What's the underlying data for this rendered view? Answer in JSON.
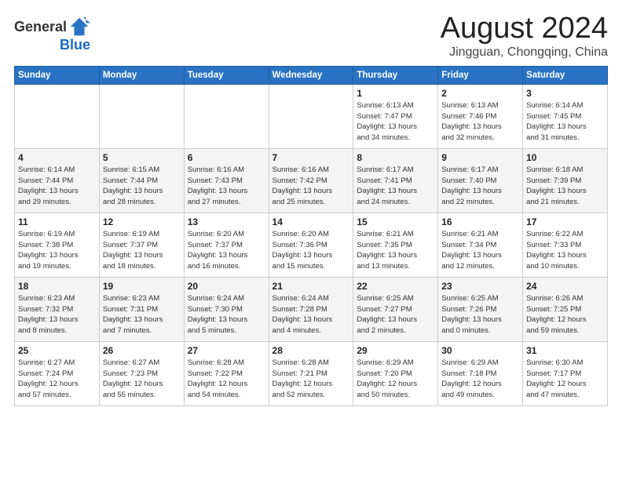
{
  "header": {
    "logo_general": "General",
    "logo_blue": "Blue",
    "month_title": "August 2024",
    "location": "Jingguan, Chongqing, China"
  },
  "weekdays": [
    "Sunday",
    "Monday",
    "Tuesday",
    "Wednesday",
    "Thursday",
    "Friday",
    "Saturday"
  ],
  "weeks": [
    [
      {
        "day": "",
        "info": ""
      },
      {
        "day": "",
        "info": ""
      },
      {
        "day": "",
        "info": ""
      },
      {
        "day": "",
        "info": ""
      },
      {
        "day": "1",
        "info": "Sunrise: 6:13 AM\nSunset: 7:47 PM\nDaylight: 13 hours\nand 34 minutes."
      },
      {
        "day": "2",
        "info": "Sunrise: 6:13 AM\nSunset: 7:46 PM\nDaylight: 13 hours\nand 32 minutes."
      },
      {
        "day": "3",
        "info": "Sunrise: 6:14 AM\nSunset: 7:45 PM\nDaylight: 13 hours\nand 31 minutes."
      }
    ],
    [
      {
        "day": "4",
        "info": "Sunrise: 6:14 AM\nSunset: 7:44 PM\nDaylight: 13 hours\nand 29 minutes."
      },
      {
        "day": "5",
        "info": "Sunrise: 6:15 AM\nSunset: 7:44 PM\nDaylight: 13 hours\nand 28 minutes."
      },
      {
        "day": "6",
        "info": "Sunrise: 6:16 AM\nSunset: 7:43 PM\nDaylight: 13 hours\nand 27 minutes."
      },
      {
        "day": "7",
        "info": "Sunrise: 6:16 AM\nSunset: 7:42 PM\nDaylight: 13 hours\nand 25 minutes."
      },
      {
        "day": "8",
        "info": "Sunrise: 6:17 AM\nSunset: 7:41 PM\nDaylight: 13 hours\nand 24 minutes."
      },
      {
        "day": "9",
        "info": "Sunrise: 6:17 AM\nSunset: 7:40 PM\nDaylight: 13 hours\nand 22 minutes."
      },
      {
        "day": "10",
        "info": "Sunrise: 6:18 AM\nSunset: 7:39 PM\nDaylight: 13 hours\nand 21 minutes."
      }
    ],
    [
      {
        "day": "11",
        "info": "Sunrise: 6:19 AM\nSunset: 7:38 PM\nDaylight: 13 hours\nand 19 minutes."
      },
      {
        "day": "12",
        "info": "Sunrise: 6:19 AM\nSunset: 7:37 PM\nDaylight: 13 hours\nand 18 minutes."
      },
      {
        "day": "13",
        "info": "Sunrise: 6:20 AM\nSunset: 7:37 PM\nDaylight: 13 hours\nand 16 minutes."
      },
      {
        "day": "14",
        "info": "Sunrise: 6:20 AM\nSunset: 7:36 PM\nDaylight: 13 hours\nand 15 minutes."
      },
      {
        "day": "15",
        "info": "Sunrise: 6:21 AM\nSunset: 7:35 PM\nDaylight: 13 hours\nand 13 minutes."
      },
      {
        "day": "16",
        "info": "Sunrise: 6:21 AM\nSunset: 7:34 PM\nDaylight: 13 hours\nand 12 minutes."
      },
      {
        "day": "17",
        "info": "Sunrise: 6:22 AM\nSunset: 7:33 PM\nDaylight: 13 hours\nand 10 minutes."
      }
    ],
    [
      {
        "day": "18",
        "info": "Sunrise: 6:23 AM\nSunset: 7:32 PM\nDaylight: 13 hours\nand 8 minutes."
      },
      {
        "day": "19",
        "info": "Sunrise: 6:23 AM\nSunset: 7:31 PM\nDaylight: 13 hours\nand 7 minutes."
      },
      {
        "day": "20",
        "info": "Sunrise: 6:24 AM\nSunset: 7:30 PM\nDaylight: 13 hours\nand 5 minutes."
      },
      {
        "day": "21",
        "info": "Sunrise: 6:24 AM\nSunset: 7:28 PM\nDaylight: 13 hours\nand 4 minutes."
      },
      {
        "day": "22",
        "info": "Sunrise: 6:25 AM\nSunset: 7:27 PM\nDaylight: 13 hours\nand 2 minutes."
      },
      {
        "day": "23",
        "info": "Sunrise: 6:25 AM\nSunset: 7:26 PM\nDaylight: 13 hours\nand 0 minutes."
      },
      {
        "day": "24",
        "info": "Sunrise: 6:26 AM\nSunset: 7:25 PM\nDaylight: 12 hours\nand 59 minutes."
      }
    ],
    [
      {
        "day": "25",
        "info": "Sunrise: 6:27 AM\nSunset: 7:24 PM\nDaylight: 12 hours\nand 57 minutes."
      },
      {
        "day": "26",
        "info": "Sunrise: 6:27 AM\nSunset: 7:23 PM\nDaylight: 12 hours\nand 55 minutes."
      },
      {
        "day": "27",
        "info": "Sunrise: 6:28 AM\nSunset: 7:22 PM\nDaylight: 12 hours\nand 54 minutes."
      },
      {
        "day": "28",
        "info": "Sunrise: 6:28 AM\nSunset: 7:21 PM\nDaylight: 12 hours\nand 52 minutes."
      },
      {
        "day": "29",
        "info": "Sunrise: 6:29 AM\nSunset: 7:20 PM\nDaylight: 12 hours\nand 50 minutes."
      },
      {
        "day": "30",
        "info": "Sunrise: 6:29 AM\nSunset: 7:18 PM\nDaylight: 12 hours\nand 49 minutes."
      },
      {
        "day": "31",
        "info": "Sunrise: 6:30 AM\nSunset: 7:17 PM\nDaylight: 12 hours\nand 47 minutes."
      }
    ]
  ]
}
